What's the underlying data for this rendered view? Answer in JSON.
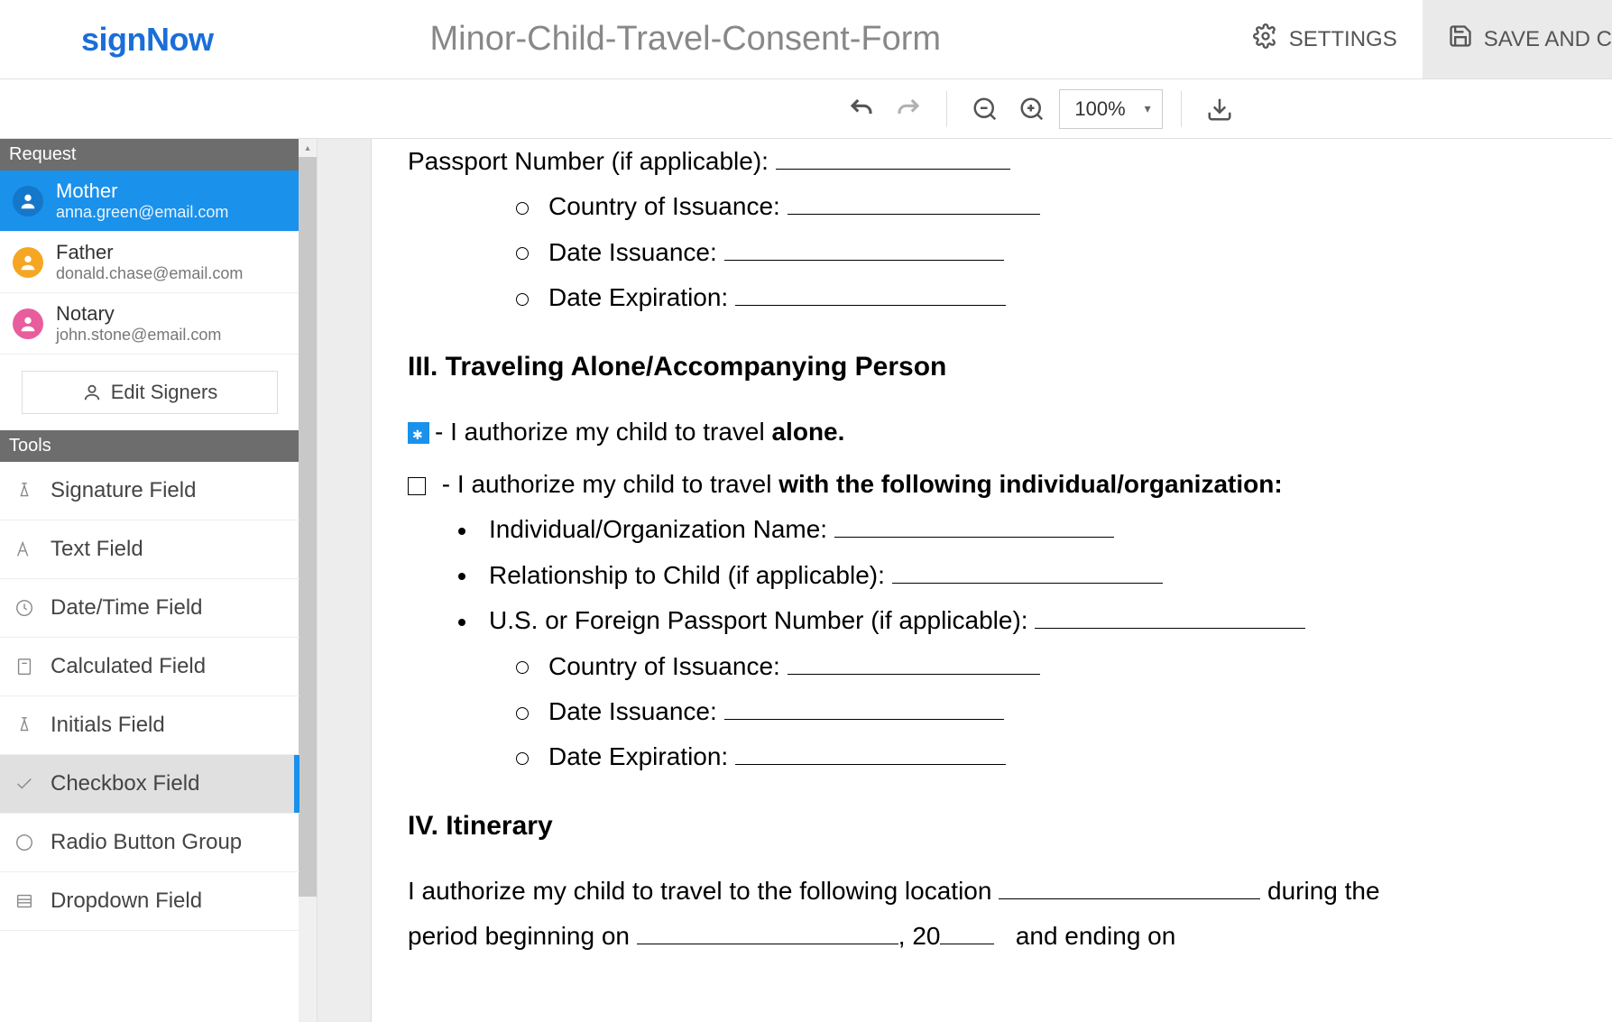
{
  "header": {
    "logo": "signNow",
    "doc_title": "Minor-Child-Travel-Consent-Form",
    "settings_label": "SETTINGS",
    "save_label": "SAVE AND C"
  },
  "toolbar": {
    "zoom": "100%"
  },
  "sidebar": {
    "request_hdr": "Request",
    "tools_hdr": "Tools",
    "edit_signers_label": "Edit Signers",
    "signers": [
      {
        "name": "Mother",
        "email": "anna.green@email.com"
      },
      {
        "name": "Father",
        "email": "donald.chase@email.com"
      },
      {
        "name": "Notary",
        "email": "john.stone@email.com"
      }
    ],
    "tools": [
      "Signature Field",
      "Text Field",
      "Date/Time Field",
      "Calculated Field",
      "Initials Field",
      "Checkbox Field",
      "Radio Button Group",
      "Dropdown Field"
    ]
  },
  "document": {
    "passport_label": "Passport Number (if applicable):",
    "country_label": "Country of Issuance:",
    "date_issue_label": "Date Issuance:",
    "date_exp_label": "Date Expiration:",
    "section3": "III. Traveling Alone/Accompanying Person",
    "alone_prefix": "- I authorize my child to travel ",
    "alone_bold": "alone.",
    "with_prefix": " - I authorize my child to travel ",
    "with_bold": "with the following individual/organization:",
    "ind_name": "Individual/Organization Name:",
    "relationship": "Relationship to Child (if applicable):",
    "us_passport": "U.S. or Foreign Passport Number (if applicable):",
    "section4": "IV. Itinerary",
    "itin_a": "I authorize my child to travel to the following location",
    "itin_b": "during the",
    "itin_c": "period beginning on",
    "itin_d": ", 20",
    "itin_e": "and ending on"
  }
}
